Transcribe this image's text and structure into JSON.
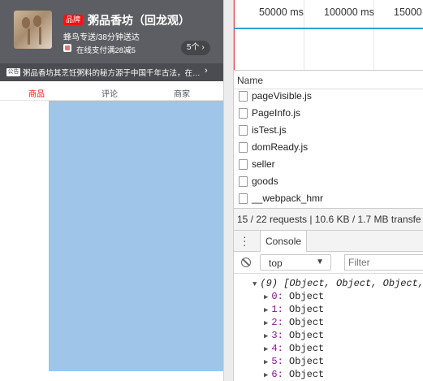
{
  "app": {
    "shop": {
      "badge": "品牌",
      "name": "粥品香坊（回龙观）",
      "delivery": "蜂鸟专送/38分钟送达",
      "support": "在线支付满28减5",
      "support_count": "5个 ›"
    },
    "bulletin": {
      "badge": "公告",
      "text": "粥品香坊其烹饪粥料的秘方源于中国千年古法，在融...",
      "arrow": "›"
    },
    "tabs": [
      {
        "label": "商品",
        "active": true
      },
      {
        "label": "评论",
        "active": false
      },
      {
        "label": "商家",
        "active": false
      }
    ],
    "colors": {
      "header": "#5d5e63",
      "active_tab": "#f01414",
      "menu_area": "#9fc5e8"
    }
  },
  "devtools": {
    "timeline": {
      "ticks": [
        "50000 ms",
        "100000 ms",
        "15000"
      ]
    },
    "network": {
      "name_header": "Name",
      "requests": [
        "pageVisible.js",
        "PageInfo.js",
        "isTest.js",
        "domReady.js",
        "seller",
        "goods",
        "__webpack_hmr"
      ],
      "status": "15 / 22 requests | 10.6 KB / 1.7 MB transfe"
    },
    "drawer": {
      "tab": "Console"
    },
    "console": {
      "context": "top",
      "filter_placeholder": "Filter",
      "array_summary": "(9) [Object, Object, Object,",
      "entries": [
        {
          "key": "0",
          "value": "Object"
        },
        {
          "key": "1",
          "value": "Object"
        },
        {
          "key": "2",
          "value": "Object"
        },
        {
          "key": "3",
          "value": "Object"
        },
        {
          "key": "4",
          "value": "Object"
        },
        {
          "key": "5",
          "value": "Object"
        },
        {
          "key": "6",
          "value": "Object"
        }
      ]
    }
  }
}
